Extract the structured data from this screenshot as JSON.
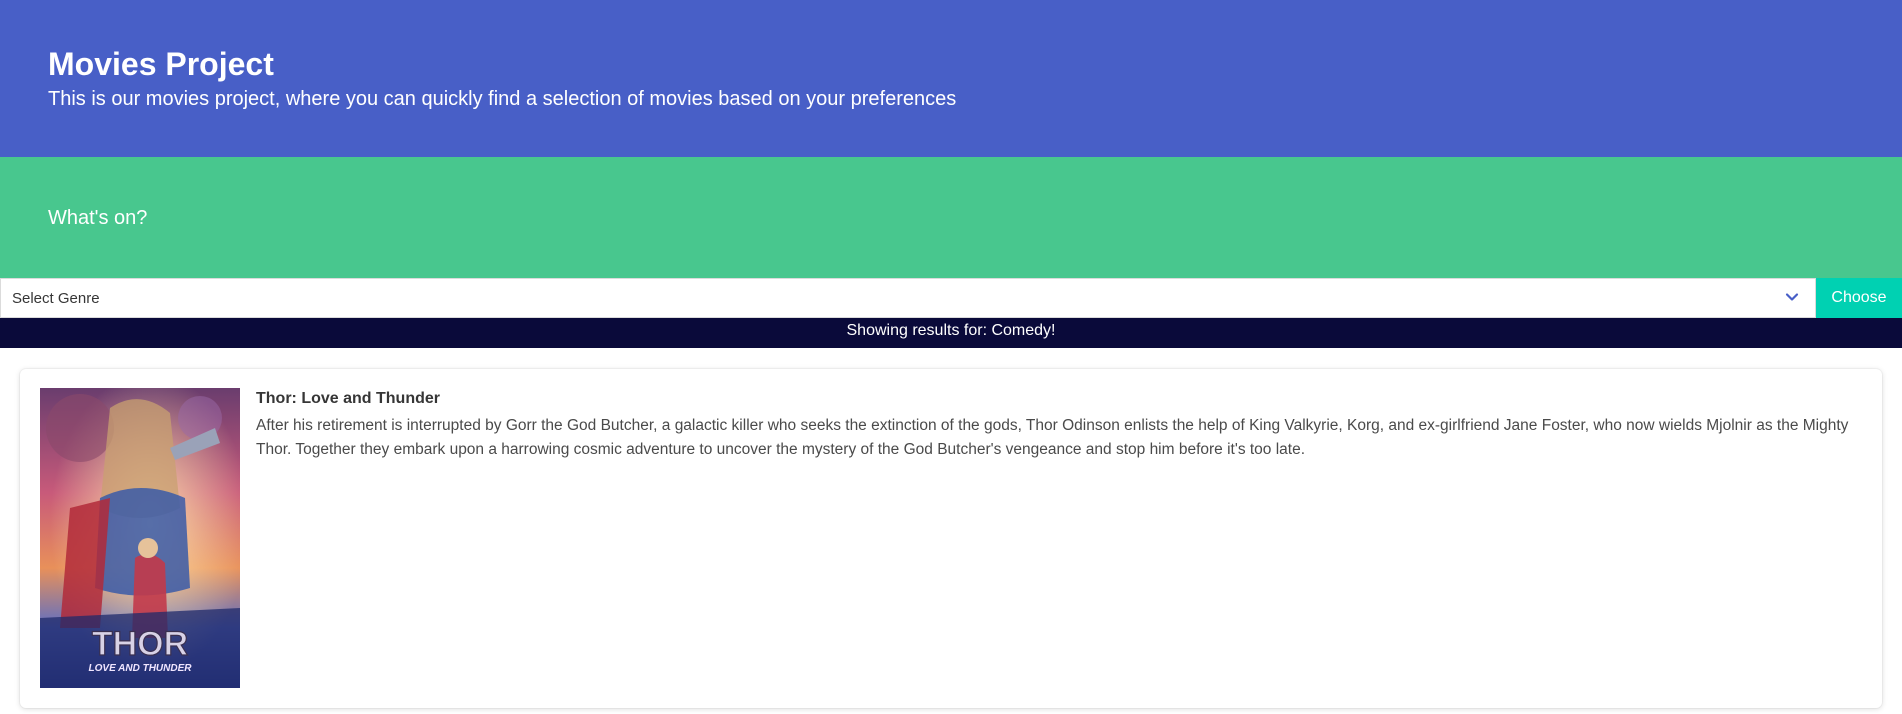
{
  "hero": {
    "title": "Movies Project",
    "subtitle": "This is our movies project, where you can quickly find a selection of movies based on your preferences"
  },
  "subhero": {
    "text": "What's on?"
  },
  "genre_filter": {
    "selected": "Select Genre",
    "choose_label": "Choose"
  },
  "status": {
    "text": "Showing results for: Comedy!"
  },
  "movies": [
    {
      "title": "Thor: Love and Thunder",
      "description": "After his retirement is interrupted by Gorr the God Butcher, a galactic killer who seeks the extinction of the gods, Thor Odinson enlists the help of King Valkyrie, Korg, and ex-girlfriend Jane Foster, who now wields Mjolnir as the Mighty Thor. Together they embark upon a harrowing cosmic adventure to uncover the mystery of the God Butcher's vengeance and stop him before it's too late.",
      "poster_logo_main": "THOR",
      "poster_logo_sub": "LOVE AND THUNDER"
    }
  ],
  "colors": {
    "hero": "#485fc7",
    "subhero": "#48c78e",
    "choose_button": "#00d1b2",
    "status_bar": "#0a0a3a"
  },
  "icons": {
    "select": "chevron-down-icon"
  }
}
